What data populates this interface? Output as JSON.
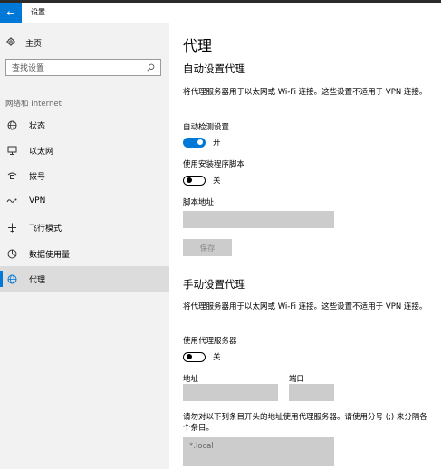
{
  "window": {
    "title": "设置",
    "back_glyph": "←"
  },
  "sidebar": {
    "home_label": "主页",
    "search_placeholder": "查找设置",
    "section": "网络和 Internet",
    "items": [
      {
        "label": "状态",
        "icon": "globe-status-icon"
      },
      {
        "label": "以太网",
        "icon": "ethernet-icon"
      },
      {
        "label": "拨号",
        "icon": "dialup-icon"
      },
      {
        "label": "VPN",
        "icon": "vpn-icon"
      },
      {
        "label": "飞行模式",
        "icon": "airplane-icon"
      },
      {
        "label": "数据使用量",
        "icon": "data-usage-icon"
      },
      {
        "label": "代理",
        "icon": "globe-icon",
        "active": true
      }
    ]
  },
  "main": {
    "title": "代理",
    "auto": {
      "heading": "自动设置代理",
      "description": "将代理服务器用于以太网或 Wi-Fi 连接。这些设置不适用于 VPN 连接。",
      "detect_label": "自动检测设置",
      "detect_state": "开",
      "script_label": "使用安装程序脚本",
      "script_state": "关",
      "address_label": "脚本地址",
      "address_value": "",
      "save_label": "保存"
    },
    "manual": {
      "heading": "手动设置代理",
      "description": "将代理服务器用于以太网或 Wi-Fi 连接。这些设置不适用于 VPN 连接。",
      "use_proxy_label": "使用代理服务器",
      "use_proxy_state": "关",
      "address_label": "地址",
      "address_value": "",
      "port_label": "端口",
      "port_value": "",
      "exceptions_label": "请勿对以下列条目开头的地址使用代理服务器。请使用分号 (;) 来分隔各个条目。",
      "exceptions_value": "*.local"
    }
  },
  "colors": {
    "accent": "#0078d7",
    "sidebar_bg": "#f2f2f2",
    "field_bg": "#cccccc"
  }
}
